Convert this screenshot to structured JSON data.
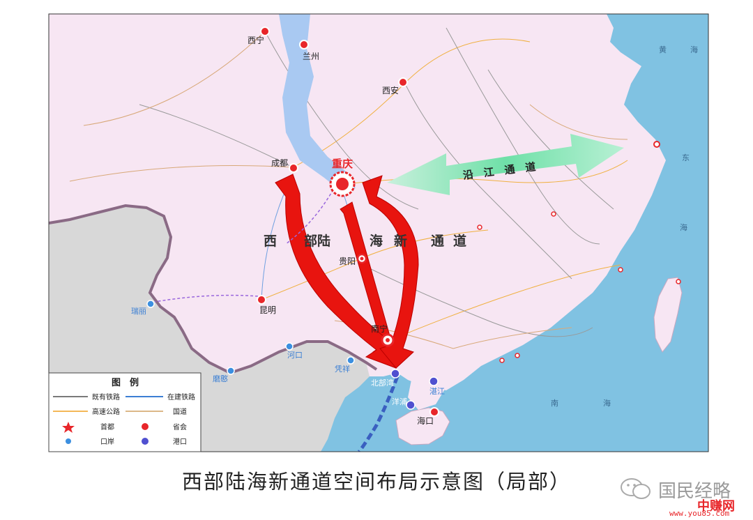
{
  "labels": {
    "xining": "西宁",
    "lanzhou": "兰州",
    "xian": "西安",
    "chengdu": "成都",
    "chongqing": "重庆",
    "guiyang": "贵阳",
    "kunming": "昆明",
    "nanning": "南宁",
    "haikou": "海口",
    "ruili": "瑞丽",
    "hekou": "河口",
    "mohan": "磨憨",
    "pingxiang": "凭祥",
    "beibuwan": "北部湾",
    "zhanjiang": "湛江",
    "yangpu": "洋浦",
    "yellow_sea_1": "黄",
    "yellow_sea_2": "海",
    "east_sea_1": "东",
    "east_sea_2": "海",
    "south_sea_1": "南",
    "south_sea_2": "海"
  },
  "corridors": {
    "western_land_sea": [
      "西",
      "部陆",
      "海",
      "新",
      "通",
      "道"
    ],
    "yangtze": "沿　江　通　道"
  },
  "legend": {
    "title": "图　例",
    "items": [
      {
        "label": "既有铁路",
        "symbol": "line",
        "color": "#7a7a7a"
      },
      {
        "label": "在建铁路",
        "symbol": "line",
        "color": "#3b7fd4"
      },
      {
        "label": "高速公路",
        "symbol": "line",
        "color": "#f0a020"
      },
      {
        "label": "国道",
        "symbol": "line",
        "color": "#d0a060"
      },
      {
        "label": "首都",
        "symbol": "star",
        "color": "#e8262a"
      },
      {
        "label": "省会",
        "symbol": "provincial-capital",
        "color": "#e8262a"
      },
      {
        "label": "口岸",
        "symbol": "dot",
        "color": "#3b8fe0"
      },
      {
        "label": "港口",
        "symbol": "port",
        "color": "#4040c0"
      }
    ]
  },
  "caption": "西部陆海新通道空间布局示意图（局部）",
  "watermark": {
    "account": "国民经略",
    "site": "中赚网",
    "url": "www.you85.com"
  },
  "colors": {
    "land": "#f6e4f2",
    "sea": "#7fc0e0",
    "foreign": "#d6d6d6",
    "arrow": "#e8140f",
    "yangtze_arrow": "#7fe0b0",
    "river": "#a8c8f0"
  }
}
